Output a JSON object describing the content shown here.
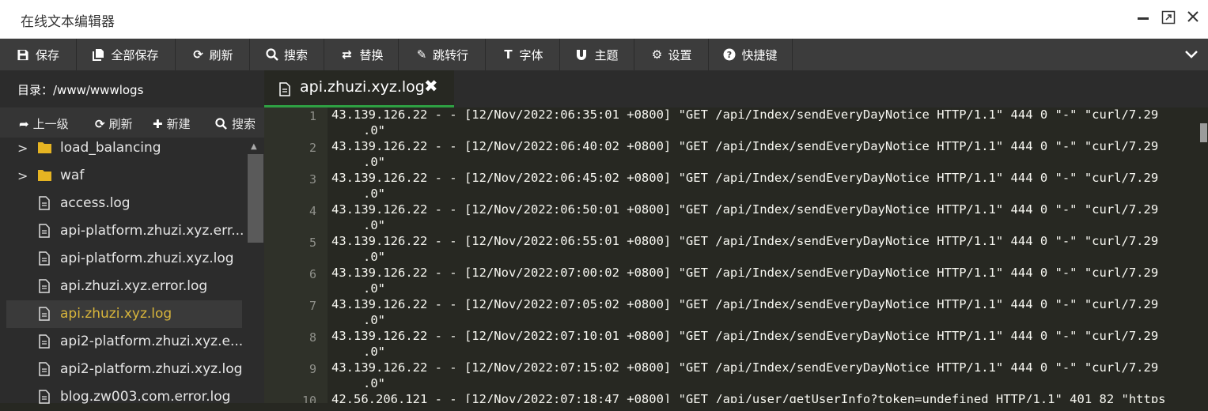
{
  "window": {
    "title": "在线文本编辑器",
    "minimize": "▬",
    "maximize": "⤢",
    "close": "✕"
  },
  "toolbar": {
    "buttons": [
      {
        "label": "保存",
        "icon": "save-icon"
      },
      {
        "label": "全部保存",
        "icon": "save-all-icon"
      },
      {
        "label": "刷新",
        "icon": "refresh-icon"
      },
      {
        "label": "搜索",
        "icon": "search-icon"
      },
      {
        "label": "替换",
        "icon": "replace-icon"
      },
      {
        "label": "跳转行",
        "icon": "pin-icon"
      },
      {
        "label": "字体",
        "icon": "text-icon"
      },
      {
        "label": "主题",
        "icon": "magnet-icon"
      },
      {
        "label": "设置",
        "icon": "gear-icon"
      },
      {
        "label": "快捷键",
        "icon": "help-icon"
      }
    ]
  },
  "sidebar": {
    "path": "目录：/www/wwwlogs",
    "actions": {
      "up": "上一级",
      "refresh": "刷新",
      "new": "新建",
      "search": "搜索"
    },
    "items": [
      {
        "label": "load_balancing",
        "type": "folder"
      },
      {
        "label": "waf",
        "type": "folder"
      },
      {
        "label": "access.log",
        "type": "file"
      },
      {
        "label": "api-platform.zhuzi.xyz.err...",
        "type": "file"
      },
      {
        "label": "api-platform.zhuzi.xyz.log",
        "type": "file"
      },
      {
        "label": "api.zhuzi.xyz.error.log",
        "type": "file"
      },
      {
        "label": "api.zhuzi.xyz.log",
        "type": "file",
        "active": true
      },
      {
        "label": "api2-platform.zhuzi.xyz.e...",
        "type": "file"
      },
      {
        "label": "api2-platform.zhuzi.xyz.log",
        "type": "file"
      },
      {
        "label": "blog.zw003.com.error.log",
        "type": "file"
      }
    ]
  },
  "editor": {
    "tab_label": "api.zhuzi.xyz.log",
    "tab_close": "✖",
    "lines": [
      {
        "no": "1",
        "text": "43.139.126.22 - - [12/Nov/2022:06:35:01 +0800] \"GET /api/Index/sendEveryDayNotice HTTP/1.1\" 444 0 \"-\" \"curl/7.29",
        "cont": ".0\""
      },
      {
        "no": "2",
        "text": "43.139.126.22 - - [12/Nov/2022:06:40:02 +0800] \"GET /api/Index/sendEveryDayNotice HTTP/1.1\" 444 0 \"-\" \"curl/7.29",
        "cont": ".0\""
      },
      {
        "no": "3",
        "text": "43.139.126.22 - - [12/Nov/2022:06:45:02 +0800] \"GET /api/Index/sendEveryDayNotice HTTP/1.1\" 444 0 \"-\" \"curl/7.29",
        "cont": ".0\""
      },
      {
        "no": "4",
        "text": "43.139.126.22 - - [12/Nov/2022:06:50:01 +0800] \"GET /api/Index/sendEveryDayNotice HTTP/1.1\" 444 0 \"-\" \"curl/7.29",
        "cont": ".0\""
      },
      {
        "no": "5",
        "text": "43.139.126.22 - - [12/Nov/2022:06:55:01 +0800] \"GET /api/Index/sendEveryDayNotice HTTP/1.1\" 444 0 \"-\" \"curl/7.29",
        "cont": ".0\""
      },
      {
        "no": "6",
        "text": "43.139.126.22 - - [12/Nov/2022:07:00:02 +0800] \"GET /api/Index/sendEveryDayNotice HTTP/1.1\" 444 0 \"-\" \"curl/7.29",
        "cont": ".0\""
      },
      {
        "no": "7",
        "text": "43.139.126.22 - - [12/Nov/2022:07:05:02 +0800] \"GET /api/Index/sendEveryDayNotice HTTP/1.1\" 444 0 \"-\" \"curl/7.29",
        "cont": ".0\""
      },
      {
        "no": "8",
        "text": "43.139.126.22 - - [12/Nov/2022:07:10:01 +0800] \"GET /api/Index/sendEveryDayNotice HTTP/1.1\" 444 0 \"-\" \"curl/7.29",
        "cont": ".0\""
      },
      {
        "no": "9",
        "text": "43.139.126.22 - - [12/Nov/2022:07:15:02 +0800] \"GET /api/Index/sendEveryDayNotice HTTP/1.1\" 444 0 \"-\" \"curl/7.29",
        "cont": ".0\""
      },
      {
        "no": "10",
        "text": "42.56.206.121 - - [12/Nov/2022:07:18:47 +0800] \"GET /api/user/getUserInfo?token=undefined HTTP/1.1\" 401 82 \"https",
        "cont": ""
      }
    ]
  },
  "colors": {
    "accent_tab": "#2ea043",
    "active_file": "#d8b53b",
    "editor_bg": "#272822"
  }
}
